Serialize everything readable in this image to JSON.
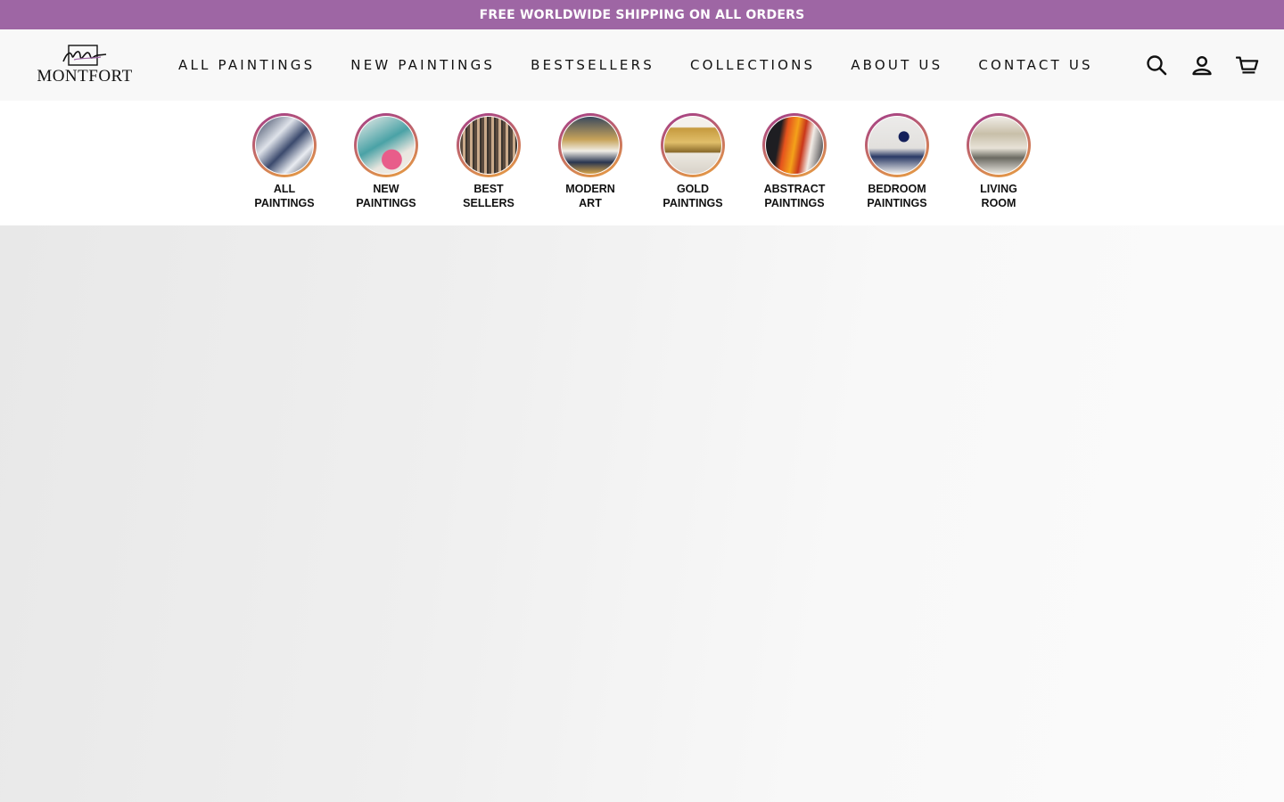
{
  "colors": {
    "announcement_bg": "#9e66a4",
    "ring_gradient_start": "#a13a8a",
    "ring_gradient_end": "#e9a040"
  },
  "announcement": {
    "text": "FREE WORLDWIDE SHIPPING ON ALL ORDERS"
  },
  "logo": {
    "text": "Montfort"
  },
  "nav": {
    "items": [
      {
        "label": "ALL PAINTINGS"
      },
      {
        "label": "NEW PAINTINGS"
      },
      {
        "label": "BESTSELLERS"
      },
      {
        "label": "COLLECTIONS"
      },
      {
        "label": "ABOUT US"
      },
      {
        "label": "CONTACT US"
      }
    ]
  },
  "header_icons": [
    "search-icon",
    "account-icon",
    "cart-icon"
  ],
  "categories": [
    {
      "line1": "ALL",
      "line2": "PAINTINGS"
    },
    {
      "line1": "NEW",
      "line2": "PAINTINGS"
    },
    {
      "line1": "BEST",
      "line2": "SELLERS"
    },
    {
      "line1": "MODERN",
      "line2": "ART"
    },
    {
      "line1": "GOLD",
      "line2": "PAINTINGS"
    },
    {
      "line1": "ABSTRACT",
      "line2": "PAINTINGS"
    },
    {
      "line1": "BEDROOM",
      "line2": "PAINTINGS"
    },
    {
      "line1": "LIVING",
      "line2": "ROOM"
    }
  ]
}
